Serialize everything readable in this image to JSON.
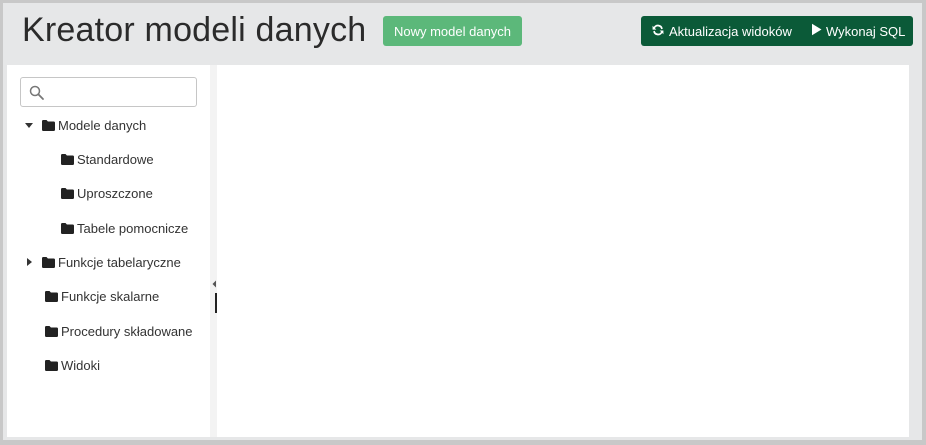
{
  "header": {
    "title": "Kreator modeli danych",
    "new_model_label": "Nowy model danych",
    "refresh_views_label": "Aktualizacja widoków",
    "run_sql_label": "Wykonaj SQL"
  },
  "sidebar": {
    "search": {
      "value": "",
      "placeholder": ""
    },
    "tree": [
      {
        "label": "Modele danych",
        "state": "expanded"
      },
      {
        "label": "Standardowe"
      },
      {
        "label": "Uproszczone"
      },
      {
        "label": "Tabele pomocnicze"
      },
      {
        "label": "Funkcje tabelaryczne",
        "state": "collapsed"
      },
      {
        "label": "Funkcje skalarne"
      },
      {
        "label": "Procedury składowane"
      },
      {
        "label": "Widoki"
      }
    ]
  },
  "colors": {
    "primary_button": "#5cb87a",
    "dark_button_group": "#0b5a38",
    "background": "#e6e7e8"
  },
  "icons": {
    "search": "search-icon",
    "folder": "folder-icon",
    "refresh": "refresh-icon",
    "play": "play-icon",
    "expanded": "caret-down-icon",
    "collapsed": "caret-right-icon"
  }
}
